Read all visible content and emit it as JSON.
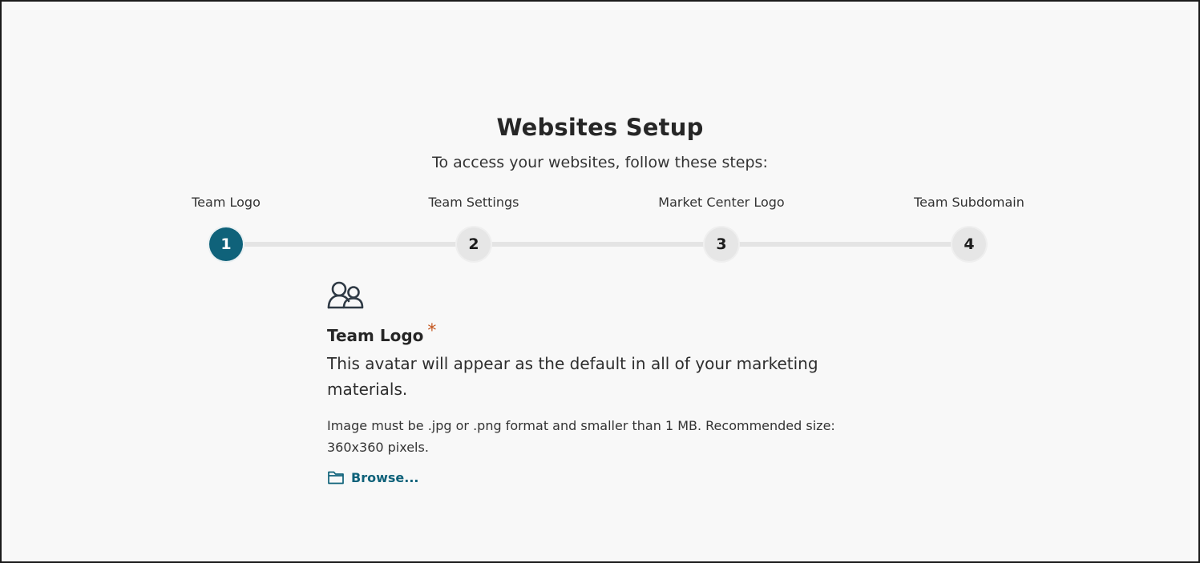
{
  "header": {
    "title": "Websites Setup",
    "subtitle": "To access your websites, follow these steps:"
  },
  "stepper": {
    "active_step": 1,
    "steps": [
      {
        "number": "1",
        "label": "Team Logo"
      },
      {
        "number": "2",
        "label": "Team Settings"
      },
      {
        "number": "3",
        "label": "Market Center Logo"
      },
      {
        "number": "4",
        "label": "Team Subdomain"
      }
    ]
  },
  "content": {
    "icon": "users-icon",
    "title": "Team Logo",
    "required_mark": "*",
    "description": "This avatar will appear as the default in all of your marketing materials.",
    "hint": "Image must be .jpg or .png format and smaller than 1 MB. Recommended size: 360x360 pixels.",
    "browse_icon": "folder-icon",
    "browse_label": "Browse..."
  },
  "colors": {
    "accent": "#0f627a",
    "required": "#c4561e",
    "background": "#f8f8f8"
  }
}
